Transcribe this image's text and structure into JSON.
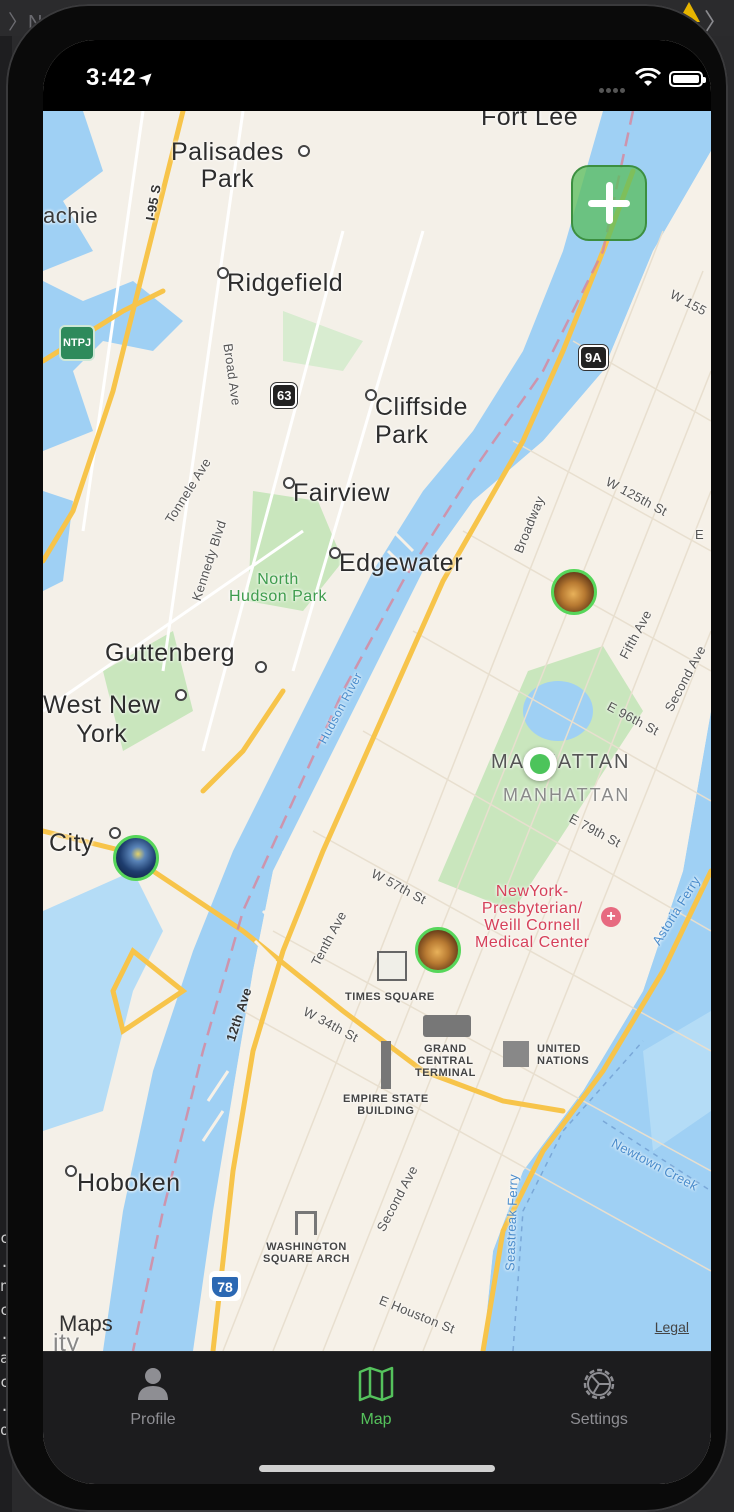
{
  "ide": {
    "breadcrumb": "〉No S",
    "next_arrow": "〉",
    "console_chars": "c\n.\nn\nc\n.\na\nc\n.\not"
  },
  "status_bar": {
    "time": "3:42",
    "location_arrow": "➤"
  },
  "map": {
    "labels": {
      "fort_lee": "Fort Lee",
      "palisades_park": "Palisades\nPark",
      "achie": "achie",
      "ridgefield": "Ridgefield",
      "broad_ave": "Broad Ave",
      "cliffside_park": "Cliffside\nPark",
      "fairview": "Fairview",
      "tonnele_ave": "Tonnele Ave",
      "kennedy_blvd": "Kennedy Blvd",
      "north_hudson_park": "North\nHudson Park",
      "edgewater": "Edgewater",
      "guttenberg": "Guttenberg",
      "west_new_york": "West New\nYork",
      "hudson_river": "Hudson River",
      "city": "City",
      "broadway": "Broadway",
      "w155": "W 155",
      "w125": "W 125th St",
      "e_short": "E",
      "fifth_ave": "Fifth Ave",
      "second_ave_up": "Second Ave",
      "e96": "E 96th St",
      "manhattan_bold": "MANHATTAN",
      "manhattan_gray": "MANHATTAN",
      "e79": "E 79th St",
      "w57": "W 57th St",
      "tenth_ave": "Tenth Ave",
      "nyp_hospital": "NewYork-\nPresbyterian/\nWeill Cornell\nMedical Center",
      "astoria_ferry": "Astoria Ferry",
      "times_square": "TIMES SQUARE",
      "twelfth_ave": "12th Ave",
      "w34": "W 34th St",
      "grand_central": "GRAND\nCENTRAL\nTERMINAL",
      "united_nations": "UNITED\nNATIONS",
      "empire_state": "EMPIRE STATE\nBUILDING",
      "newtown_creek": "Newtown Creek",
      "hoboken": "Hoboken",
      "second_ave_low": "Second Ave",
      "seastreak_ferry": "Seastreak Ferry",
      "washington_square": "WASHINGTON\nSQUARE ARCH",
      "e_houston": "E Houston St",
      "ity": "ity"
    },
    "shields": {
      "i95": "I-95 S",
      "nj63": "63",
      "ny9a": "9A",
      "i78": "78",
      "njtp": "NTPJ"
    },
    "attribution": {
      "maps": "Maps",
      "legal": "Legal"
    },
    "pins": [
      {
        "name": "lion",
        "style": "lion"
      },
      {
        "name": "starry-night",
        "style": "night"
      },
      {
        "name": "lion",
        "style": "lion"
      }
    ]
  },
  "tabs": [
    {
      "label": "Profile",
      "icon": "person-icon",
      "active": false
    },
    {
      "label": "Map",
      "icon": "map-icon",
      "active": true
    },
    {
      "label": "Settings",
      "icon": "gear-icon",
      "active": false
    }
  ],
  "colors": {
    "accent": "#55c25c",
    "water": "#9fd0f4",
    "park": "#c9e6bd",
    "highway": "#f7c44a",
    "tabbar": "#1c1c1e"
  }
}
